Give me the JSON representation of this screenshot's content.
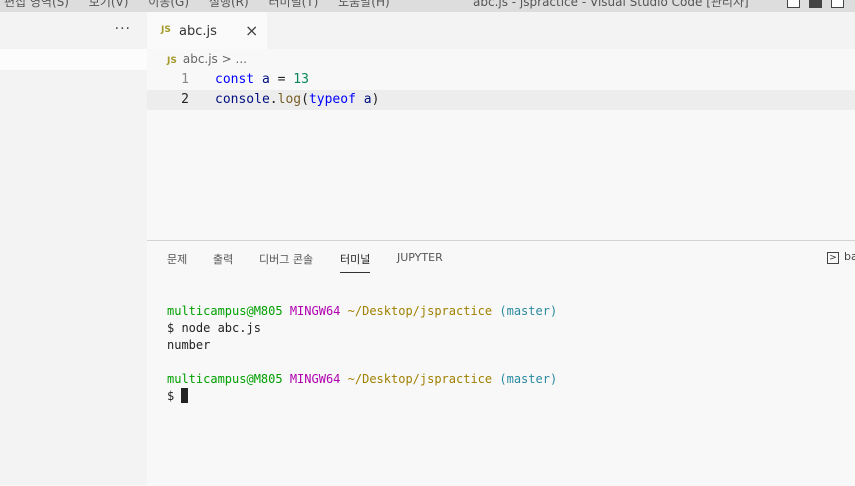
{
  "menu": [
    "편집 영역(S)",
    "보기(V)",
    "이동(G)",
    "실행(R)",
    "터미널(T)",
    "도움말(H)"
  ],
  "window_title": "abc.js - jspractice - Visual Studio Code [관리자]",
  "sidebar": {
    "more_label": "···"
  },
  "tab": {
    "badge": "JS",
    "label": "abc.js",
    "close": "×"
  },
  "breadcrumb": {
    "badge": "JS",
    "file": "abc.js",
    "sep": ">",
    "rest": "..."
  },
  "editor": {
    "lines": [
      {
        "num": "1",
        "t": [
          "const",
          "a",
          "=",
          "13"
        ]
      },
      {
        "num": "2",
        "t": [
          "console",
          ".",
          "log",
          "(",
          "typeof",
          "a",
          ")"
        ]
      }
    ]
  },
  "panel": {
    "tabs": [
      "문제",
      "출력",
      "디버그 콘솔",
      "터미널",
      "JUPYTER"
    ],
    "active_tab": "터미널",
    "terminal_name": "ba"
  },
  "terminal": {
    "user": "multicampus@M805",
    "system": "MINGW64",
    "path": "~/Desktop/jspractice",
    "branch": "(master)",
    "command": "$ node abc.js",
    "output": "number",
    "prompt": "$"
  }
}
